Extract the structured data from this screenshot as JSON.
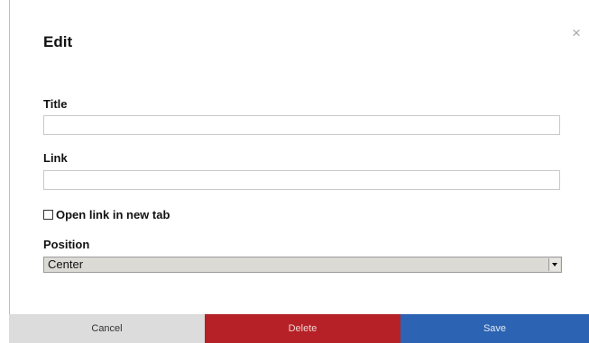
{
  "dialog": {
    "title": "Edit",
    "close_symbol": "×"
  },
  "fields": {
    "title_label": "Title",
    "title_value": "",
    "link_label": "Link",
    "link_value": "",
    "open_new_tab_label": "Open link in new tab",
    "open_new_tab_checked": false,
    "position_label": "Position",
    "position_value": "Center"
  },
  "buttons": {
    "cancel": "Cancel",
    "delete": "Delete",
    "save": "Save"
  },
  "colors": {
    "delete": "#b52126",
    "save": "#2c63b2",
    "cancel": "#dcdcdc"
  },
  "icons": {
    "close": "close-icon",
    "checkbox": "checkbox-unchecked",
    "dropdown": "chevron-down-icon"
  }
}
